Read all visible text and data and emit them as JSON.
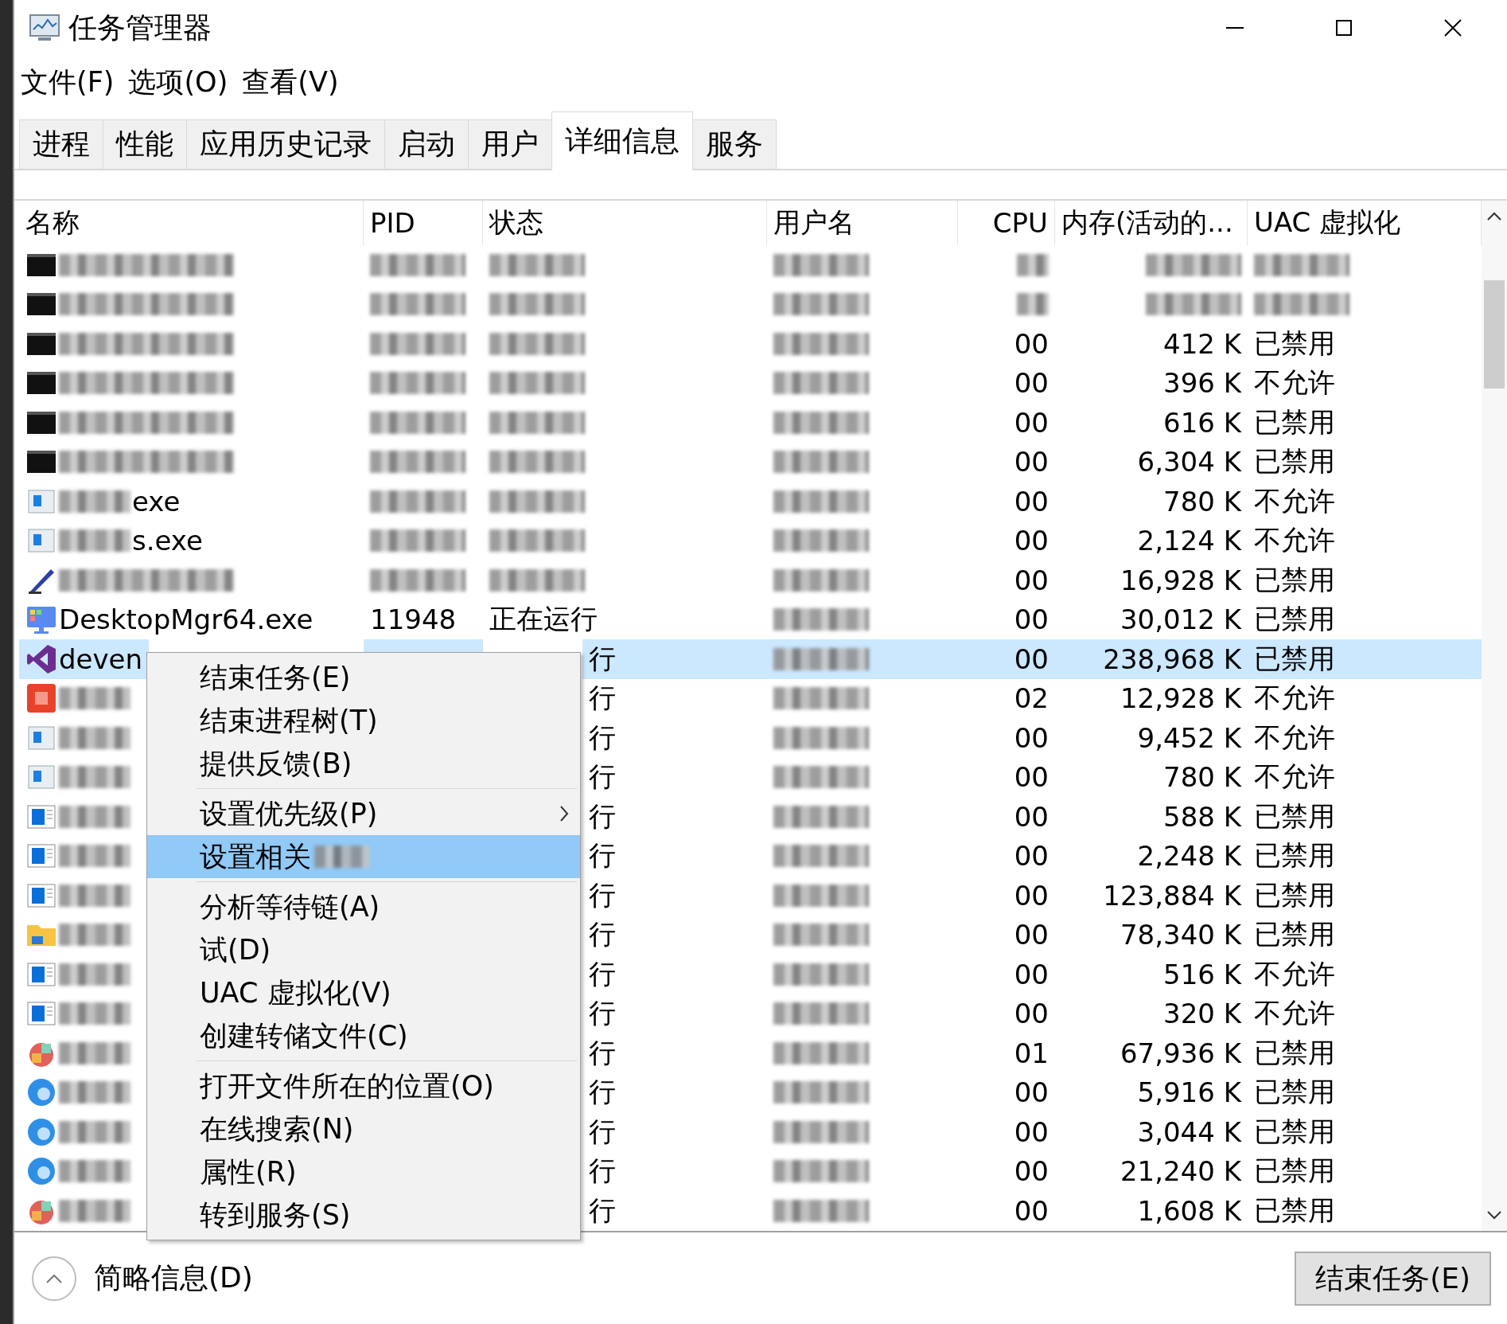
{
  "window": {
    "title": "任务管理器"
  },
  "menu_bar": [
    "文件(F)",
    "选项(O)",
    "查看(V)"
  ],
  "tabs": [
    {
      "label": "进程",
      "selected": false
    },
    {
      "label": "性能",
      "selected": false
    },
    {
      "label": "应用历史记录",
      "selected": false
    },
    {
      "label": "启动",
      "selected": false
    },
    {
      "label": "用户",
      "selected": false
    },
    {
      "label": "详细信息",
      "selected": true
    },
    {
      "label": "服务",
      "selected": false
    }
  ],
  "table": {
    "columns": [
      "名称",
      "PID",
      "状态",
      "用户名",
      "CPU",
      "内存(活动的...",
      "UAC 虚拟化"
    ],
    "rows": [
      {
        "kind": "console",
        "selected": false,
        "name": {
          "redacted": true
        },
        "pid": {
          "redacted": true
        },
        "status": {
          "redacted": true
        },
        "user": {
          "redacted": true
        },
        "cpu": {
          "redacted": true
        },
        "memory": {
          "redacted": true
        },
        "uac": {
          "redacted": true
        }
      },
      {
        "kind": "console",
        "selected": false,
        "name": {
          "redacted": true
        },
        "pid": {
          "redacted": true
        },
        "status": {
          "redacted": true
        },
        "user": {
          "redacted": true
        },
        "cpu": {
          "redacted": true
        },
        "memory": {
          "redacted": true
        },
        "uac": {
          "redacted": true
        }
      },
      {
        "kind": "console",
        "selected": false,
        "name": {
          "redacted": true
        },
        "pid": {
          "redacted": true
        },
        "status": {
          "redacted": true
        },
        "user": {
          "redacted": true
        },
        "cpu": {
          "text": "00"
        },
        "memory": {
          "text": "412 K"
        },
        "uac": {
          "text": "已禁用"
        }
      },
      {
        "kind": "console",
        "selected": false,
        "name": {
          "redacted": true
        },
        "pid": {
          "redacted": true
        },
        "status": {
          "redacted": true
        },
        "user": {
          "redacted": true
        },
        "cpu": {
          "text": "00"
        },
        "memory": {
          "text": "396 K"
        },
        "uac": {
          "text": "不允许"
        }
      },
      {
        "kind": "console",
        "selected": false,
        "name": {
          "redacted": true
        },
        "pid": {
          "redacted": true
        },
        "status": {
          "redacted": true
        },
        "user": {
          "redacted": true
        },
        "cpu": {
          "text": "00"
        },
        "memory": {
          "text": "616 K"
        },
        "uac": {
          "text": "已禁用"
        }
      },
      {
        "kind": "console",
        "selected": false,
        "name": {
          "redacted": true
        },
        "pid": {
          "redacted": true
        },
        "status": {
          "redacted": true
        },
        "user": {
          "redacted": true
        },
        "cpu": {
          "text": "00"
        },
        "memory": {
          "text": "6,304 K"
        },
        "uac": {
          "text": "已禁用"
        }
      },
      {
        "kind": "service",
        "selected": false,
        "name": {
          "text": "exe",
          "redacted": true
        },
        "pid": {
          "redacted": true
        },
        "status": {
          "redacted": true
        },
        "user": {
          "redacted": true
        },
        "cpu": {
          "text": "00"
        },
        "memory": {
          "text": "780 K"
        },
        "uac": {
          "text": "不允许"
        }
      },
      {
        "kind": "service",
        "selected": false,
        "name": {
          "text": "s.exe",
          "redacted": true
        },
        "pid": {
          "redacted": true
        },
        "status": {
          "redacted": true
        },
        "user": {
          "redacted": true
        },
        "cpu": {
          "text": "00"
        },
        "memory": {
          "text": "2,124 K"
        },
        "uac": {
          "text": "不允许"
        }
      },
      {
        "kind": "pen",
        "selected": false,
        "name": {
          "redacted": true
        },
        "pid": {
          "redacted": true
        },
        "status": {
          "redacted": true
        },
        "user": {
          "redacted": true
        },
        "cpu": {
          "text": "00"
        },
        "memory": {
          "text": "16,928 K"
        },
        "uac": {
          "text": "已禁用"
        }
      },
      {
        "kind": "monitor",
        "selected": false,
        "name": {
          "text": "DesktopMgr64.exe"
        },
        "pid": {
          "text": "11948"
        },
        "status": {
          "text": "正在运行"
        },
        "user": {
          "redacted": true
        },
        "cpu": {
          "text": "00"
        },
        "memory": {
          "text": "30,012 K"
        },
        "uac": {
          "text": "已禁用"
        }
      },
      {
        "kind": "studio",
        "selected": true,
        "name": {
          "text": "deven"
        },
        "status": {
          "text": "行",
          "clipped": true
        },
        "user": {
          "redacted": true
        },
        "cpu": {
          "text": "00"
        },
        "memory": {
          "text": "238,968 K"
        },
        "uac": {
          "text": "已禁用"
        }
      },
      {
        "kind": "red",
        "selected": false,
        "name": {
          "redacted": true
        },
        "status": {
          "text": "行",
          "clipped": true
        },
        "user": {
          "redacted": true
        },
        "cpu": {
          "text": "02"
        },
        "memory": {
          "text": "12,928 K"
        },
        "uac": {
          "text": "不允许"
        }
      },
      {
        "kind": "service",
        "selected": false,
        "name": {
          "redacted": true
        },
        "status": {
          "text": "行",
          "clipped": true
        },
        "user": {
          "redacted": true
        },
        "cpu": {
          "text": "00"
        },
        "memory": {
          "text": "9,452 K"
        },
        "uac": {
          "text": "不允许"
        }
      },
      {
        "kind": "service",
        "selected": false,
        "name": {
          "redacted": true
        },
        "status": {
          "text": "行",
          "clipped": true
        },
        "user": {
          "redacted": true
        },
        "cpu": {
          "text": "00"
        },
        "memory": {
          "text": "780 K"
        },
        "uac": {
          "text": "不允许"
        }
      },
      {
        "kind": "window",
        "selected": false,
        "name": {
          "redacted": true
        },
        "status": {
          "text": "行",
          "clipped": true
        },
        "user": {
          "redacted": true
        },
        "cpu": {
          "text": "00"
        },
        "memory": {
          "text": "588 K"
        },
        "uac": {
          "text": "已禁用"
        }
      },
      {
        "kind": "window",
        "selected": false,
        "name": {
          "redacted": true
        },
        "status": {
          "text": "行",
          "clipped": true
        },
        "user": {
          "redacted": true
        },
        "cpu": {
          "text": "00"
        },
        "memory": {
          "text": "2,248 K"
        },
        "uac": {
          "text": "已禁用"
        }
      },
      {
        "kind": "window",
        "selected": false,
        "name": {
          "redacted": true
        },
        "status": {
          "text": "行",
          "clipped": true
        },
        "user": {
          "redacted": true
        },
        "cpu": {
          "text": "00"
        },
        "memory": {
          "text": "123,884 K"
        },
        "uac": {
          "text": "已禁用"
        }
      },
      {
        "kind": "folder",
        "selected": false,
        "name": {
          "redacted": true
        },
        "status": {
          "text": "行",
          "clipped": true
        },
        "user": {
          "redacted": true
        },
        "cpu": {
          "text": "00"
        },
        "memory": {
          "text": "78,340 K"
        },
        "uac": {
          "text": "已禁用"
        }
      },
      {
        "kind": "window",
        "selected": false,
        "name": {
          "redacted": true
        },
        "status": {
          "text": "行",
          "clipped": true
        },
        "user": {
          "redacted": true
        },
        "cpu": {
          "text": "00"
        },
        "memory": {
          "text": "516 K"
        },
        "uac": {
          "text": "不允许"
        }
      },
      {
        "kind": "window",
        "selected": false,
        "name": {
          "redacted": true
        },
        "status": {
          "text": "行",
          "clipped": true
        },
        "user": {
          "redacted": true
        },
        "cpu": {
          "text": "00"
        },
        "memory": {
          "text": "320 K"
        },
        "uac": {
          "text": "不允许"
        }
      },
      {
        "kind": "tiles",
        "selected": false,
        "name": {
          "redacted": true
        },
        "status": {
          "text": "行",
          "clipped": true
        },
        "user": {
          "redacted": true
        },
        "cpu": {
          "text": "01"
        },
        "memory": {
          "text": "67,936 K"
        },
        "uac": {
          "text": "已禁用"
        }
      },
      {
        "kind": "edge",
        "selected": false,
        "name": {
          "redacted": true
        },
        "status": {
          "text": "行",
          "clipped": true
        },
        "user": {
          "redacted": true
        },
        "cpu": {
          "text": "00"
        },
        "memory": {
          "text": "5,916 K"
        },
        "uac": {
          "text": "已禁用"
        }
      },
      {
        "kind": "edge",
        "selected": false,
        "name": {
          "redacted": true
        },
        "status": {
          "text": "行",
          "clipped": true
        },
        "user": {
          "redacted": true
        },
        "cpu": {
          "text": "00"
        },
        "memory": {
          "text": "3,044 K"
        },
        "uac": {
          "text": "已禁用"
        }
      },
      {
        "kind": "edge",
        "selected": false,
        "name": {
          "redacted": true
        },
        "status": {
          "text": "行",
          "clipped": true
        },
        "user": {
          "redacted": true
        },
        "cpu": {
          "text": "00"
        },
        "memory": {
          "text": "21,240 K"
        },
        "uac": {
          "text": "已禁用"
        }
      },
      {
        "kind": "tiles",
        "selected": false,
        "name": {
          "redacted": true
        },
        "status": {
          "text": "行",
          "clipped": true
        },
        "user": {
          "redacted": true
        },
        "cpu": {
          "text": "00"
        },
        "memory": {
          "text": "1,608 K"
        },
        "uac": {
          "text": "已禁用"
        }
      }
    ]
  },
  "context_menu": {
    "groups": [
      [
        {
          "label": "结束任务(E)",
          "selected": false
        },
        {
          "label": "结束进程树(T)",
          "selected": false
        },
        {
          "label": "提供反馈(B)",
          "selected": false
        }
      ],
      [
        {
          "label": "设置优先级(P)",
          "selected": false,
          "submenu": true
        },
        {
          "label": "设置相关",
          "selected": true,
          "redacted": true
        }
      ],
      [
        {
          "label": "分析等待链(A)",
          "selected": false
        },
        {
          "label": "试(D)",
          "selected": false
        },
        {
          "label": "UAC 虚拟化(V)",
          "selected": false
        },
        {
          "label": "创建转储文件(C)",
          "selected": false
        }
      ],
      [
        {
          "label": "打开文件所在的位置(O)",
          "selected": false
        },
        {
          "label": "在线搜索(N)",
          "selected": false
        },
        {
          "label": "属性(R)",
          "selected": false
        },
        {
          "label": "转到服务(S)",
          "selected": false
        }
      ]
    ]
  },
  "footer": {
    "toggle_label": "简略信息(D)",
    "end_task_button": "结束任务(E)"
  }
}
